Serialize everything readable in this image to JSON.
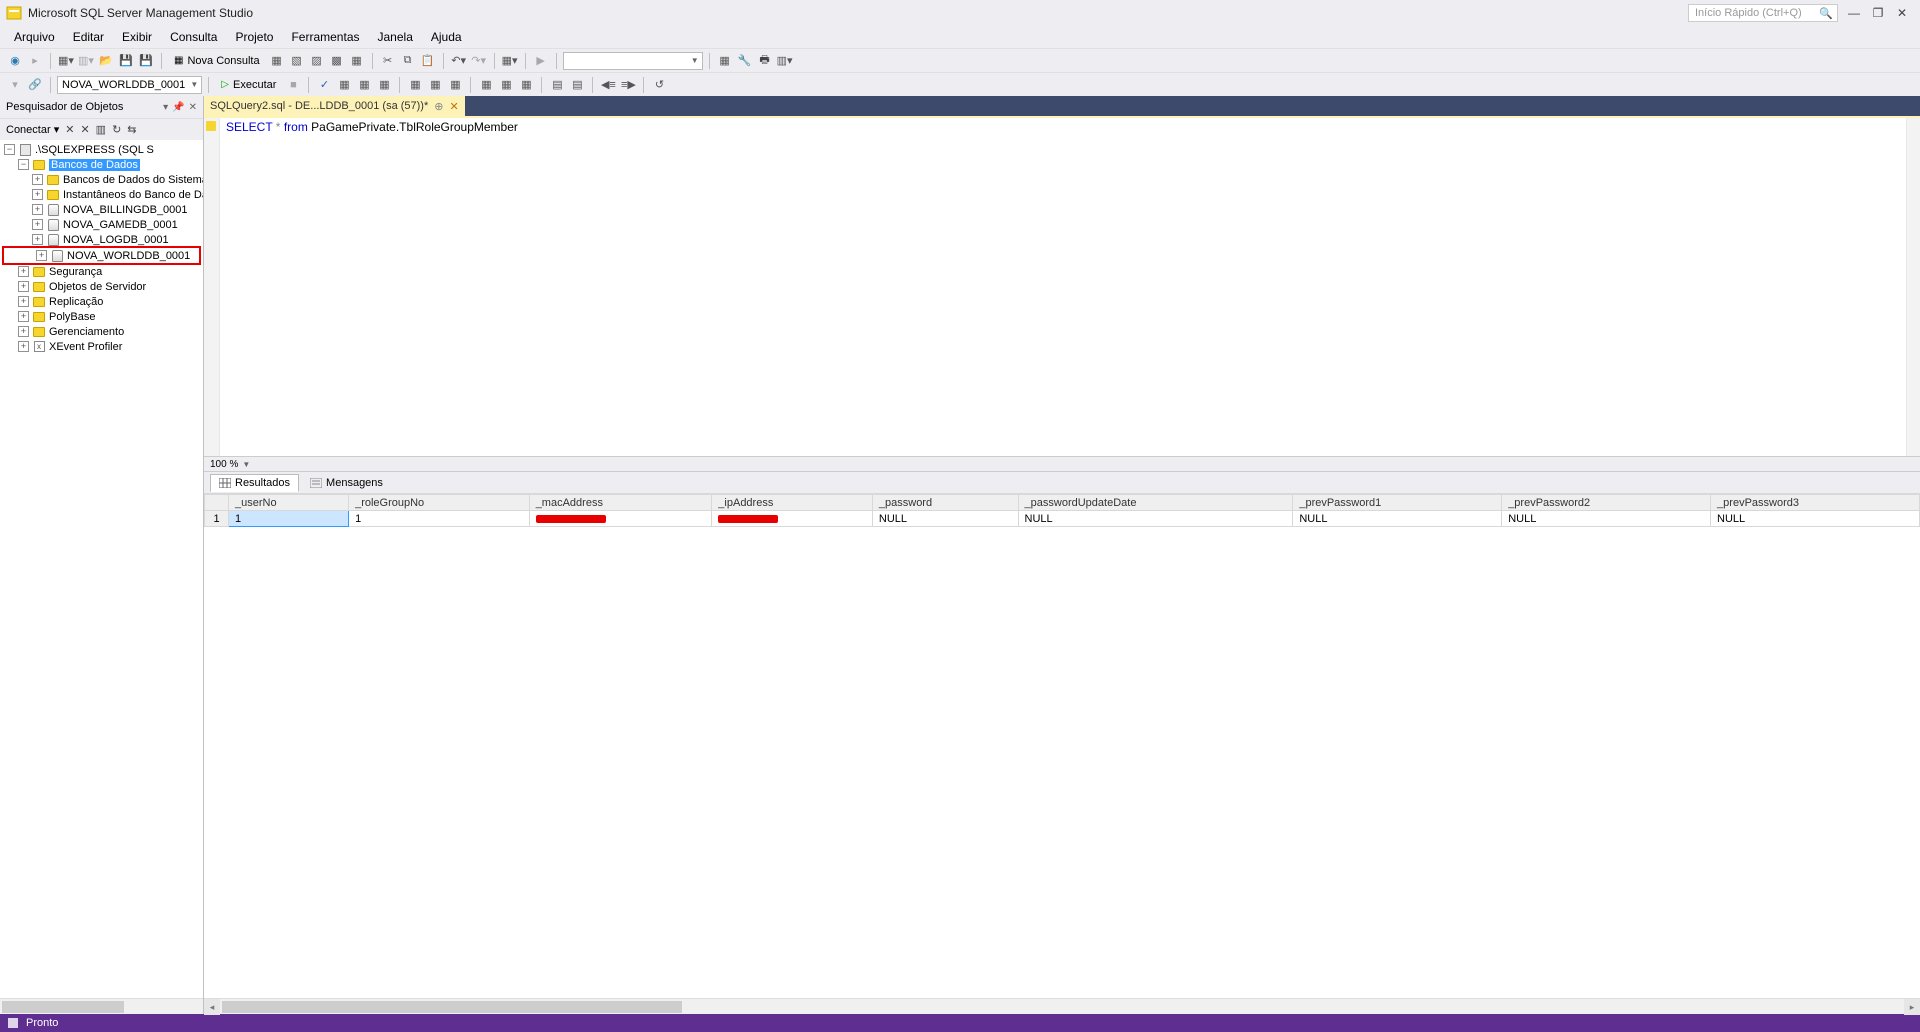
{
  "title": "Microsoft SQL Server Management Studio",
  "quicklaunch_placeholder": "Início Rápido (Ctrl+Q)",
  "menu": [
    "Arquivo",
    "Editar",
    "Exibir",
    "Consulta",
    "Projeto",
    "Ferramentas",
    "Janela",
    "Ajuda"
  ],
  "toolbar1": {
    "new_query": "Nova Consulta"
  },
  "toolbar2": {
    "db_combo": "NOVA_WORLDDB_0001",
    "execute": "Executar"
  },
  "objexp": {
    "title": "Pesquisador de Objetos",
    "connect": "Conectar",
    "root": ".\\SQLEXPRESS (SQL S",
    "nodes": {
      "databases": "Bancos de Dados",
      "sysdb": "Bancos de Dados do Sistema",
      "snapshots": "Instantâneos do Banco de Dado",
      "billing": "NOVA_BILLINGDB_0001",
      "gamedb": "NOVA_GAMEDB_0001",
      "logdb": "NOVA_LOGDB_0001",
      "worlddb": "NOVA_WORLDDB_0001",
      "security": "Segurança",
      "serverobj": "Objetos de Servidor",
      "replication": "Replicação",
      "polybase": "PolyBase",
      "management": "Gerenciamento",
      "xevent": "XEvent Profiler"
    }
  },
  "tab": {
    "label": "SQLQuery2.sql - DE...LDDB_0001 (sa (57))*"
  },
  "sql": {
    "kw1": "SELECT",
    "star": " * ",
    "kw2": "from",
    "rest": " PaGamePrivate.TblRoleGroupMember"
  },
  "zoom": "100 %",
  "results_tabs": {
    "results": "Resultados",
    "messages": "Mensagens"
  },
  "grid": {
    "headers": [
      "_userNo",
      "_roleGroupNo",
      "_macAddress",
      "_ipAddress",
      "_password",
      "_passwordUpdateDate",
      "_prevPassword1",
      "_prevPassword2",
      "_prevPassword3"
    ],
    "row1": {
      "n": "1",
      "userNo": "1",
      "roleGroupNo": "1",
      "password": "NULL",
      "passwordUpdateDate": "NULL",
      "prev1": "NULL",
      "prev2": "NULL",
      "prev3": "NULL"
    }
  },
  "status": "Pronto"
}
